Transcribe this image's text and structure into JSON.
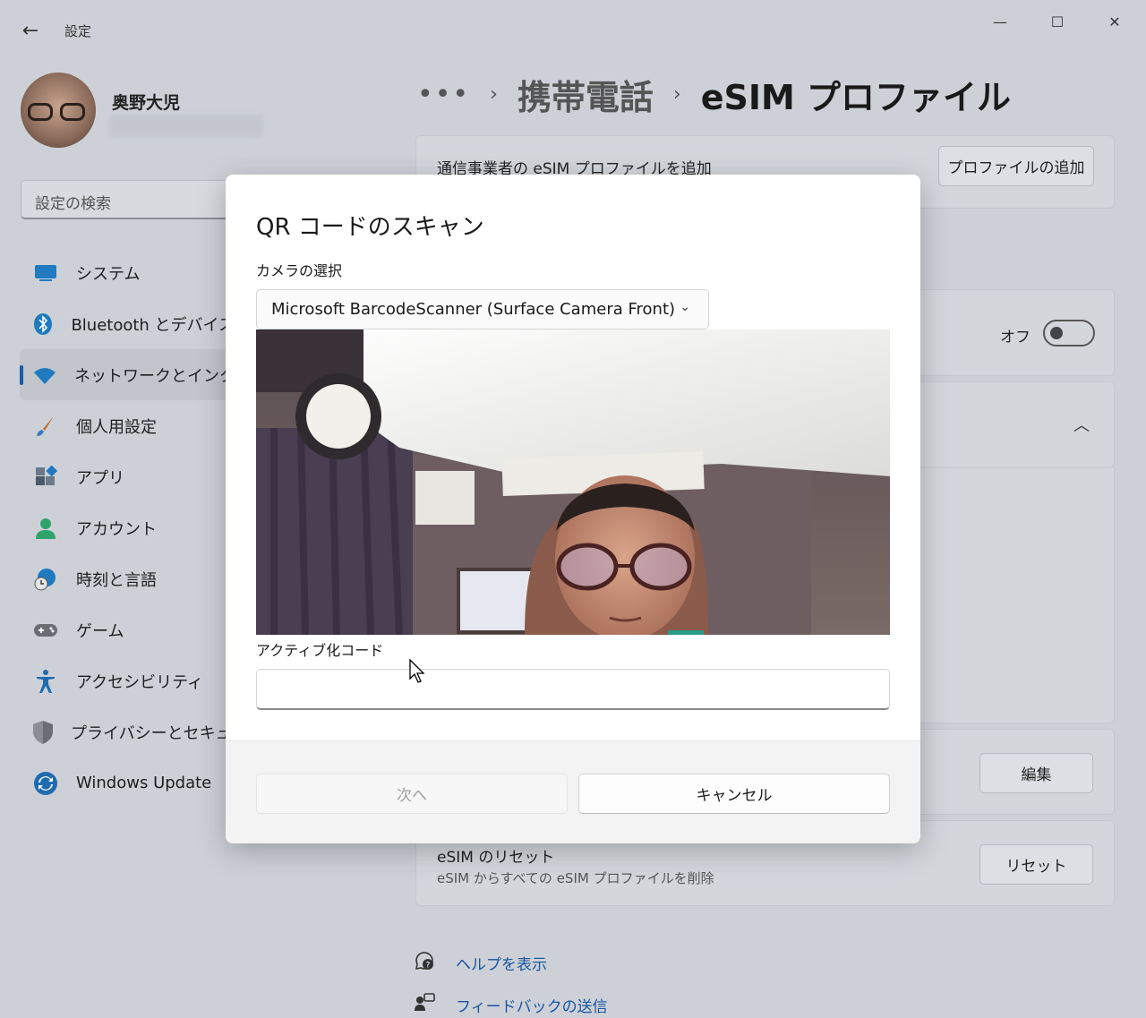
{
  "window": {
    "app_title": "設定",
    "controls": {
      "minimize": "—",
      "maximize": "☐",
      "close": "✕"
    }
  },
  "sidebar": {
    "user_name": "奥野大児",
    "search_placeholder": "設定の検索",
    "items": [
      {
        "label": "システム",
        "icon": "system-icon",
        "color": "#1f7ac0"
      },
      {
        "label": "Bluetooth とデバイス",
        "icon": "bluetooth-icon",
        "color": "#1f7ac0"
      },
      {
        "label": "ネットワークとインターネット",
        "icon": "wifi-icon",
        "color": "#1f7ac0",
        "active": true
      },
      {
        "label": "個人用設定",
        "icon": "brush-icon",
        "color": "#c46b2b"
      },
      {
        "label": "アプリ",
        "icon": "apps-icon",
        "color": "#4a5a6a"
      },
      {
        "label": "アカウント",
        "icon": "account-icon",
        "color": "#2fa36b"
      },
      {
        "label": "時刻と言語",
        "icon": "globe-clock-icon",
        "color": "#1f7ac0"
      },
      {
        "label": "ゲーム",
        "icon": "gamepad-icon",
        "color": "#6a6a6a"
      },
      {
        "label": "アクセシビリティ",
        "icon": "accessibility-icon",
        "color": "#1f6bb0"
      },
      {
        "label": "プライバシーとセキュリティ",
        "icon": "shield-icon",
        "color": "#6a6e74"
      },
      {
        "label": "Windows Update",
        "icon": "update-icon",
        "color": "#1f6bb0"
      }
    ]
  },
  "breadcrumb": {
    "more": "•••",
    "parent": "携帯電話",
    "current": "eSIM プロファイル"
  },
  "main": {
    "add_profile_text": "通信事業者の eSIM プロファイルを追加",
    "add_profile_button": "プロファイルの追加",
    "toggle_label": "オフ",
    "edit_button": "編集",
    "reset_title": "eSIM のリセット",
    "reset_desc": "eSIM からすべての eSIM プロファイルを削除",
    "reset_button": "リセット",
    "help_link": "ヘルプを表示",
    "feedback_link": "フィードバックの送信"
  },
  "dialog": {
    "title": "QR コードのスキャン",
    "camera_label": "カメラの選択",
    "camera_value": "Microsoft BarcodeScanner (Surface Camera Front)",
    "activation_label": "アクティブ化コード",
    "activation_value": "",
    "next_button": "次へ",
    "cancel_button": "キャンセル"
  }
}
